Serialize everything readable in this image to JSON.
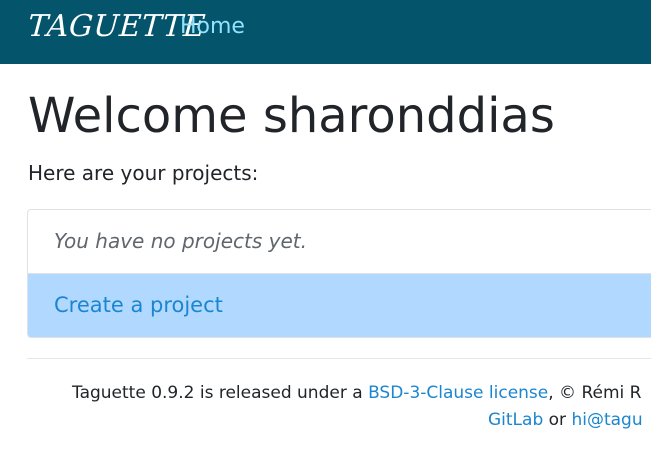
{
  "navbar": {
    "brand": "TAGUETTE",
    "home_label": "Home"
  },
  "main": {
    "title": "Welcome sharonddias",
    "subtitle": "Here are your projects:",
    "empty_message": "You have no projects yet.",
    "create_label": "Create a project"
  },
  "footer": {
    "line1_prefix": "Taguette 0.9.2 is released under a ",
    "license_link": "BSD-3-Clause license",
    "line1_suffix": ", © Rémi R",
    "gitlab_link": "GitLab",
    "line2_mid": " or ",
    "email_link": "hi@tagu"
  },
  "colors": {
    "navbar_bg": "#04546b",
    "link": "#1b86cf",
    "create_bg": "#b1d9ff"
  }
}
